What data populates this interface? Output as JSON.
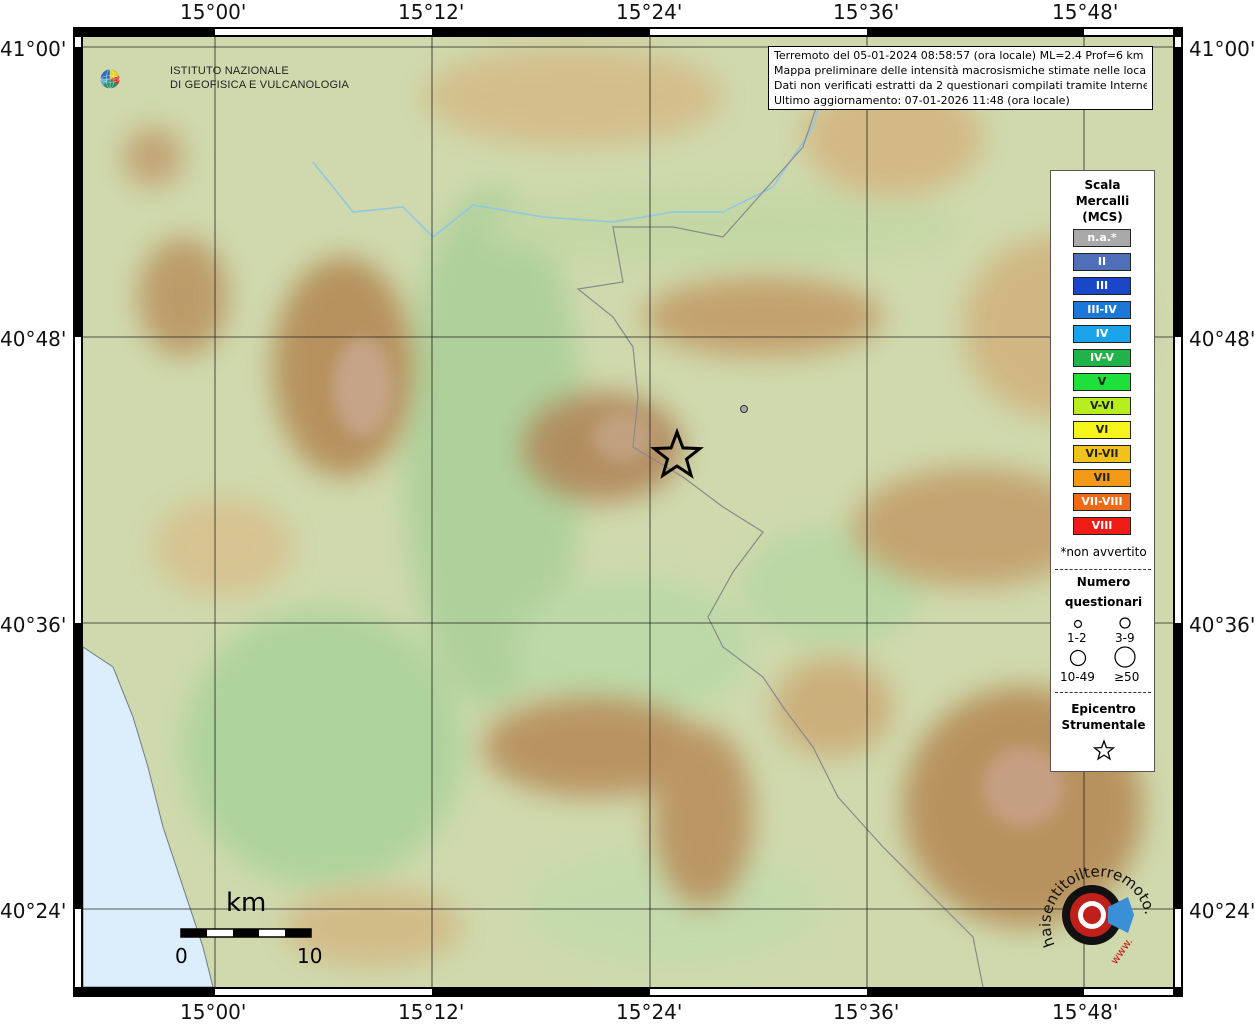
{
  "map": {
    "lon_ticks": [
      "15°00'",
      "15°12'",
      "15°24'",
      "15°36'",
      "15°48'"
    ],
    "lat_ticks_left": [
      "41°00'",
      "40°48'",
      "40°36'",
      "40°24'"
    ],
    "lat_ticks_right": [
      "41°00'",
      "40°48'",
      "40°36'",
      "40°24'"
    ],
    "land_color": "#c9d6a8",
    "sea_color": "#dceefc",
    "relief_color": "#b8915a",
    "river_color": "#8fc6e6",
    "border_color": "#888888"
  },
  "info": {
    "line1": "Terremoto del 05-01-2024 08:58:57 (ora locale) ML=2.4 Prof=6 km",
    "line2": "Mappa preliminare delle intensità macrosismiche stimate nelle località",
    "line3": "Dati non verificati estratti da 2 questionari compilati tramite Internet.",
    "line4": "Ultimo aggiornamento: 07-01-2026 11:48 (ora locale)"
  },
  "logo": {
    "line1": "ISTITUTO NAZIONALE",
    "line2": "DI GEOFISICA E VULCANOLOGIA"
  },
  "legend": {
    "title1": "Scala",
    "title2": "Mercalli",
    "title3": "(MCS)",
    "scale": [
      {
        "label": "n.a.*",
        "color": "#a9a9a9"
      },
      {
        "label": "II",
        "color": "#4f6fb8"
      },
      {
        "label": "III",
        "color": "#1947c8"
      },
      {
        "label": "III-IV",
        "color": "#1c78d6"
      },
      {
        "label": "IV",
        "color": "#1aa3e8"
      },
      {
        "label": "IV-V",
        "color": "#22b24a"
      },
      {
        "label": "V",
        "color": "#1fe03a"
      },
      {
        "label": "V-VI",
        "color": "#b7ee1e"
      },
      {
        "label": "VI",
        "color": "#f5f51c"
      },
      {
        "label": "VI-VII",
        "color": "#f2c21c"
      },
      {
        "label": "VII",
        "color": "#f29a18"
      },
      {
        "label": "VII-VIII",
        "color": "#ef6a18"
      },
      {
        "label": "VIII",
        "color": "#ee1c14"
      }
    ],
    "note": "*non avvertito",
    "count_title1": "Numero",
    "count_title2": "questionari",
    "counts": [
      "1-2",
      "3-9",
      "10-49",
      "≥50"
    ],
    "epi_title1": "Epicentro",
    "epi_title2": "Strumentale"
  },
  "scalebar": {
    "unit": "km",
    "min": "0",
    "max": "10"
  },
  "hst_logo": {
    "text": "haisentitoilterremoto.it",
    "www": "www."
  }
}
